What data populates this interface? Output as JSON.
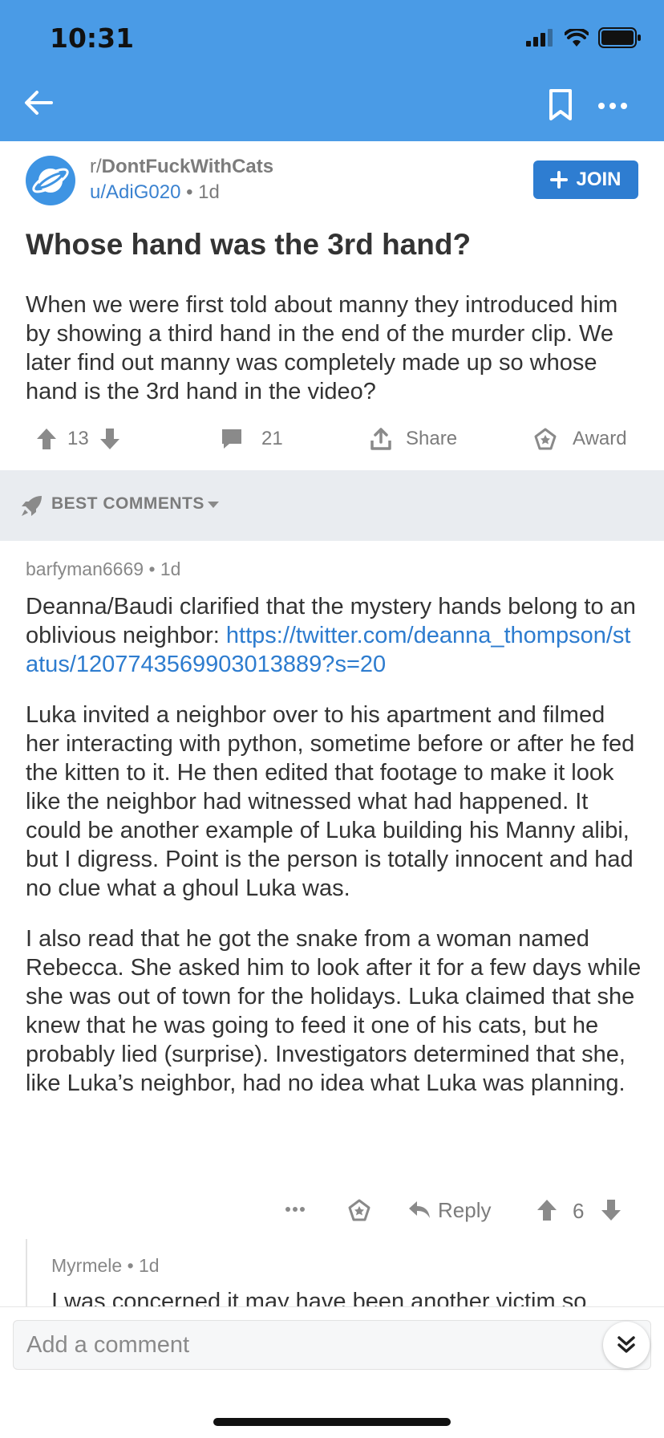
{
  "status_bar": {
    "time": "10:31"
  },
  "nav": {
    "back_icon": "arrow-left-icon",
    "bookmark_icon": "bookmark-icon",
    "more_icon": "ellipsis-icon"
  },
  "post": {
    "subreddit_prefix": "r/",
    "subreddit": "DontFuckWithCats",
    "author": "u/AdiG020",
    "age": "• 1d",
    "join_label": "JOIN",
    "title": "Whose hand was the 3rd hand?",
    "body": "When we were first told about manny they introduced him by showing a third hand in the end of the murder clip. We later find out manny was completely made up so whose hand is the 3rd hand in the video?",
    "score": "13",
    "comments": "21",
    "share_label": "Share",
    "award_label": "Award"
  },
  "sort": {
    "label": "BEST COMMENTS"
  },
  "comment": {
    "author": "barfyman6669",
    "age": "• 1d",
    "p1_text": "Deanna/Baudi clarified that the mystery hands belong to an oblivious neighbor: ",
    "p1_link": "https://twitter.com/deanna_thompson/status/1207743569903013889?s=20",
    "p2": "Luka invited a neighbor over to his apartment and filmed her interacting with python, sometime before or after he fed the kitten to it. He then edited that footage to make it look like the neighbor had witnessed what had happened. It could be another example of Luka building his Manny alibi, but I digress. Point is the person is totally innocent and had no clue what a ghoul Luka was.",
    "p3": "I also read that he got the snake from a woman named Rebecca. She asked him to look after it for a few days while she was out of  town for the holidays. Luka claimed that she knew that he was going to feed it one of his cats, but he probably lied (surprise). Investigators determined that she, like Luka’s neighbor, had no idea what Luka was planning.",
    "reply_label": "Reply",
    "score": "6"
  },
  "reply": {
    "author": "Myrmele",
    "age": "• 1d",
    "text": "I was concerned it may have been another victim so"
  },
  "composer": {
    "placeholder": "Add a comment"
  },
  "colors": {
    "header_blue": "#4a9be6",
    "join_blue": "#2e7dd1",
    "link_blue": "#2d7ccf",
    "band_gray": "#e9ecf0"
  }
}
